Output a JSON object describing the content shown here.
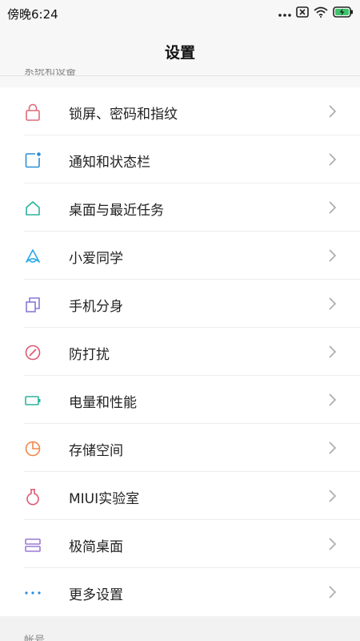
{
  "status_bar": {
    "time": "傍晚6:24",
    "icons": [
      "more-dots-icon",
      "close-box-icon",
      "wifi-icon",
      "battery-charging-icon"
    ]
  },
  "header": {
    "title": "设置"
  },
  "section_top": {
    "label": "系统和设备"
  },
  "settings": {
    "items": [
      {
        "label": "锁屏、密码和指纹",
        "icon": "lock-icon",
        "color": "#e06a7a"
      },
      {
        "label": "通知和状态栏",
        "icon": "notification-icon",
        "color": "#2a8fd6"
      },
      {
        "label": "桌面与最近任务",
        "icon": "home-icon",
        "color": "#2bb39b"
      },
      {
        "label": "小爱同学",
        "icon": "xiaoai-icon",
        "color": "#28a9e8"
      },
      {
        "label": "手机分身",
        "icon": "second-space-icon",
        "color": "#8c79d8"
      },
      {
        "label": "防打扰",
        "icon": "do-not-disturb-icon",
        "color": "#e05a73"
      },
      {
        "label": "电量和性能",
        "icon": "battery-icon",
        "color": "#2bb39b"
      },
      {
        "label": "存储空间",
        "icon": "storage-pie-icon",
        "color": "#f0884a"
      },
      {
        "label": "MIUI实验室",
        "icon": "lab-flask-icon",
        "color": "#e05a73"
      },
      {
        "label": "极简桌面",
        "icon": "simple-mode-icon",
        "color": "#9c79d8"
      },
      {
        "label": "更多设置",
        "icon": "more-dots-icon",
        "color": "#2a8fd6"
      }
    ]
  },
  "section_bottom": {
    "label": "帐号"
  }
}
